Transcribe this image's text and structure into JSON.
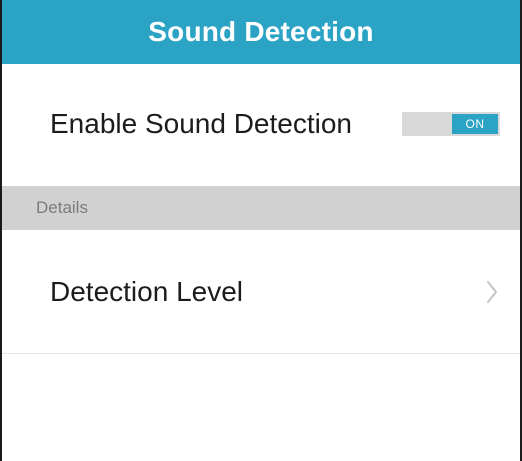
{
  "header": {
    "title": "Sound Detection"
  },
  "settings": {
    "enable_label": "Enable Sound Detection",
    "toggle_state": "ON",
    "section_title": "Details",
    "detection_level_label": "Detection Level"
  },
  "icons": {
    "chevron": "chevron-right-icon"
  },
  "colors": {
    "accent": "#2aa3c5",
    "section_bg": "#d1d1d1",
    "toggle_track": "#d9d9d9"
  }
}
